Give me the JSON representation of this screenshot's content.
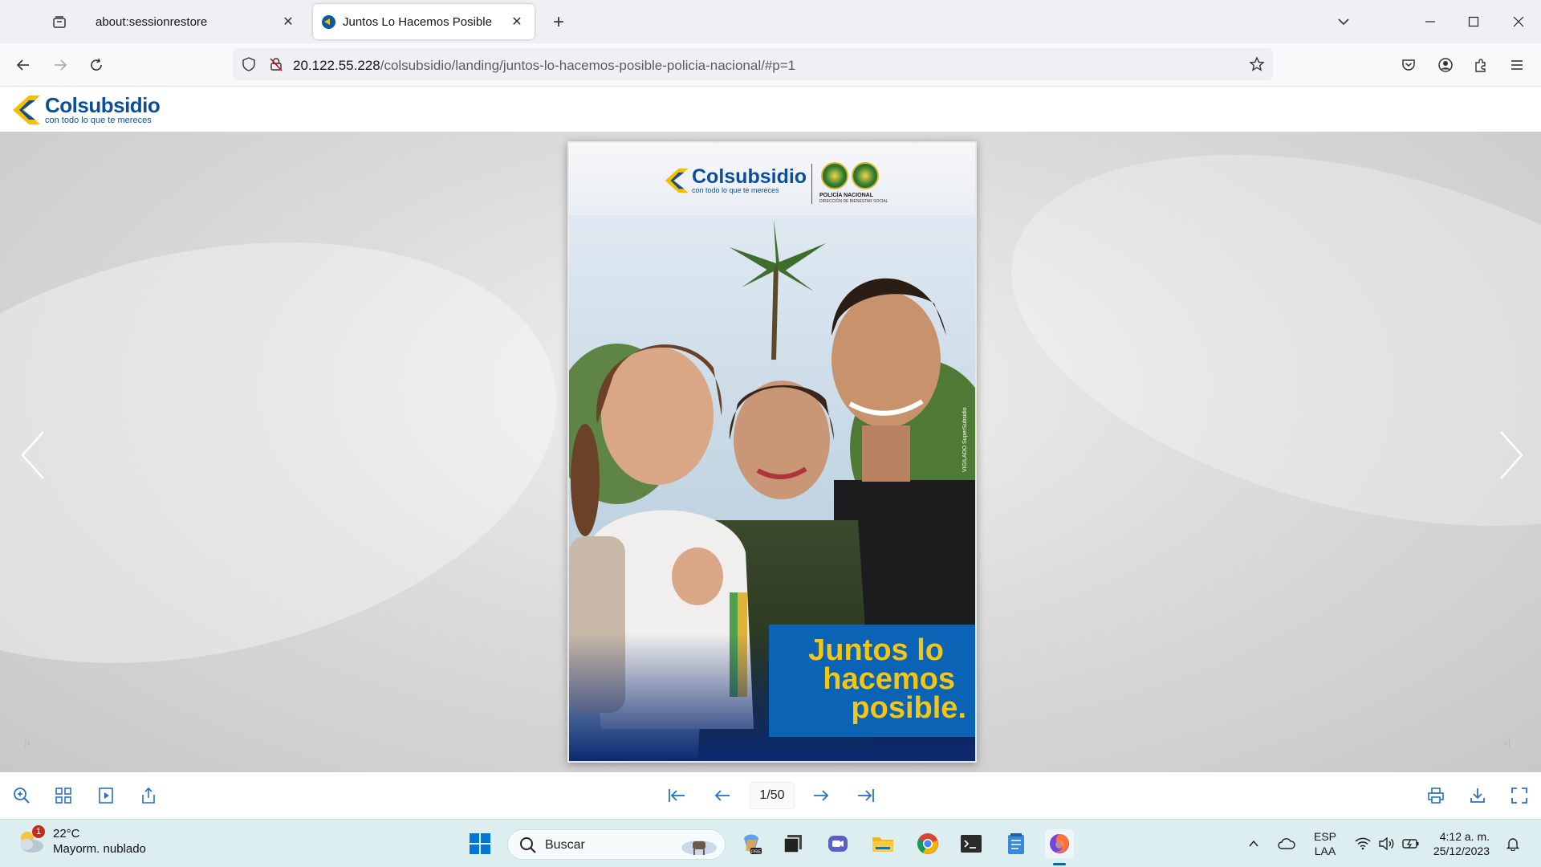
{
  "browser": {
    "tabs": [
      {
        "title": "about:sessionrestore",
        "active": false
      },
      {
        "title": "Juntos Lo Hacemos Posible",
        "active": true
      }
    ],
    "url_host": "20.122.55.228",
    "url_path": "/colsubsidio/landing/juntos-lo-hacemos-posible-policia-nacional/#p=1"
  },
  "site": {
    "logo_name": "Colsubsidio",
    "logo_tagline": "con todo lo que te mereces"
  },
  "flipbook": {
    "cover": {
      "logo_name": "Colsubsidio",
      "logo_tagline": "con todo lo que te mereces",
      "police_name": "POLICÍA NACIONAL",
      "police_sub": "DIRECCIÓN DE BIENESTAR SOCIAL",
      "headline_lines": [
        "Juntos lo",
        "hacemos",
        "posible."
      ],
      "vertical_note": "VIGILADO SuperSubsidio",
      "accent_yellow": "#f3c613",
      "banner_blue": "#0a63b5"
    },
    "page_counter": "1/50"
  },
  "taskbar": {
    "weather_temp": "22°C",
    "weather_desc": "Mayorm. nublado",
    "weather_badge": "1",
    "search_placeholder": "Buscar",
    "lang_line1": "ESP",
    "lang_line2": "LAA",
    "time": "4:12 a. m.",
    "date": "25/12/2023"
  }
}
